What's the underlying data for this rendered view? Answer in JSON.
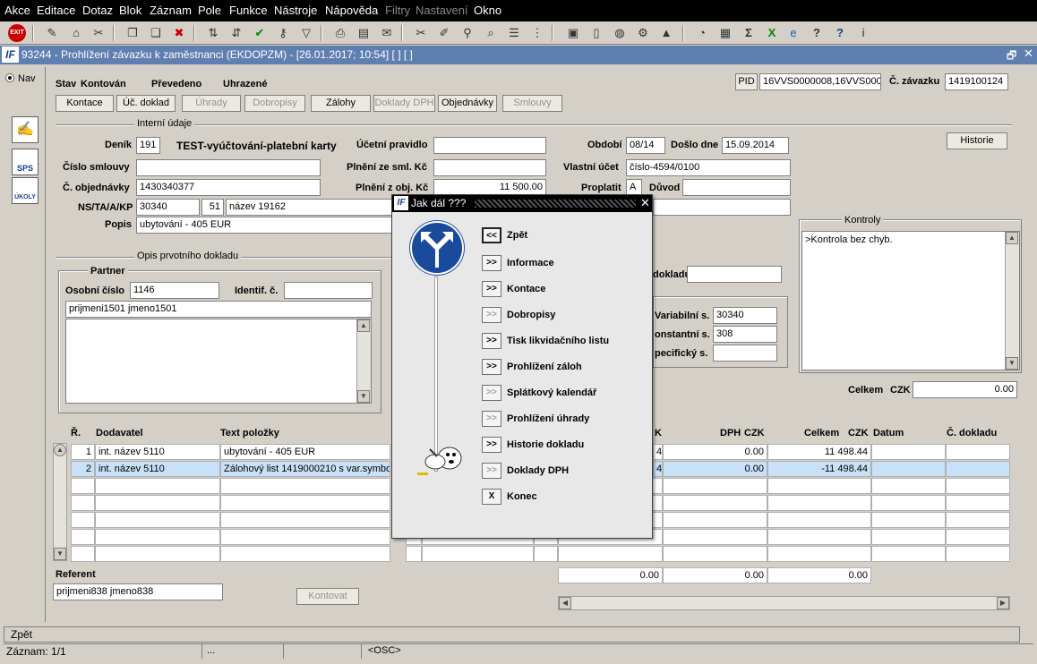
{
  "menu": [
    "Akce",
    "Editace",
    "Dotaz",
    "Blok",
    "Záznam",
    "Pole",
    "Funkce",
    "Nástroje",
    "Nápověda",
    "Filtry",
    "Nastavení",
    "Okno"
  ],
  "menu_disabled": [
    "Filtry",
    "Nastavení"
  ],
  "window": {
    "title": "93244 - Prohlížení závazku k zaměstnanci (EKDOPZM) - [26.01.2017; 10:54]  [ ]  [ ]"
  },
  "nav": {
    "label": "Nav"
  },
  "side_icons": [
    "SPS",
    "ÚKOLY"
  ],
  "status": {
    "stav_label": "Stav",
    "kontovan": "Kontován",
    "prevedeno": "Převedeno",
    "uhrazene": "Uhrazené"
  },
  "pid": {
    "label": "PID",
    "value": "16VVS0000008,16VVS000",
    "cislo_zavazku_label": "Č. závazku",
    "cislo_zavazku": "1419100124"
  },
  "tabs": [
    "Kontace",
    "Úč. doklad",
    "Úhrady",
    "Dobropisy",
    "Zálohy",
    "Doklady DPH",
    "Objednávky",
    "Smlouvy"
  ],
  "tabs_disabled": [
    "Úhrady",
    "Dobropisy",
    "Doklady DPH",
    "Smlouvy"
  ],
  "sections": {
    "interni": "Interní údaje",
    "opis": "Opis prvotního dokladu",
    "partner": "Partner",
    "kontroly": "Kontroly"
  },
  "form": {
    "denik_label": "Deník",
    "denik": "191",
    "denik_nazev": "TEST-vyúčtování-platební karty",
    "ucetni_pravidlo_label": "Účetní pravidlo",
    "ucetni_pravidlo": "",
    "obdobi_label": "Období",
    "obdobi": "08/14",
    "doslo_label": "Došlo dne",
    "doslo": "15.09.2014",
    "historie": "Historie",
    "cislo_smlouvy_label": "Číslo smlouvy",
    "cislo_smlouvy": "",
    "plneni_sml_label": "Plnění ze sml. Kč",
    "plneni_sml": "",
    "vlastni_ucet_label": "Vlastní účet",
    "vlastni_ucet": "číslo-4594/0100",
    "cislo_obj_label": "Č. objednávky",
    "cislo_obj": "1430340377",
    "plneni_obj_label": "Plnění z obj. Kč",
    "plneni_obj": "11 500.00",
    "proplatit_label": "Proplatit",
    "proplatit": "A",
    "duvod_label": "Důvod",
    "duvod": "",
    "ns_label": "NS/TA/A/KP",
    "ns": "30340",
    "ns2": "51",
    "ns_nazev": "název 19162",
    "popis_label": "Popis",
    "popis": "ubytování - 405 EUR",
    "kontroly_text": ">Kontrola bez chyb.",
    "osobni_label": "Osobní číslo",
    "osobni": "1146",
    "identif_label": "Identif. č.",
    "identif": "",
    "partner_name": "prijmeni1501 jmeno1501",
    "dokladu_label": "dokladu",
    "dokladu": "",
    "variabilni_label": "Variabilní s.",
    "variabilni": "30340",
    "konstantni_label": "onstantní s.",
    "konstantni": "308",
    "specificky_label": "pecifický s.",
    "specificky": "",
    "celkem_label": "Celkem",
    "celkem_cur": "CZK",
    "celkem": "0.00"
  },
  "table": {
    "headers": {
      "r": "Ř.",
      "dodavatel": "Dodavatel",
      "text": "Text položky",
      "k": "K",
      "dph": "DPH",
      "dph_cur": "CZK",
      "celkem": "Celkem",
      "celkem_cur": "CZK",
      "datum": "Datum",
      "doklad": "Č. dokladu"
    },
    "rows": [
      {
        "r": "1",
        "dodavatel": "int. název 5110",
        "text": "ubytování - 405 EUR",
        "k": "4",
        "dph": "0.00",
        "celkem": "11 498.44",
        "datum": "",
        "doklad": ""
      },
      {
        "r": "2",
        "dodavatel": "int. název 5110",
        "text": "Zálohový list 1419000210 s var.symbo",
        "k": "4",
        "dph": "0.00",
        "celkem": "-11 498.44",
        "datum": "",
        "doklad": ""
      }
    ],
    "totals": [
      "0.00",
      "0.00",
      "0.00"
    ]
  },
  "referent": {
    "label": "Referent",
    "value": "prijmeni838 jmeno838"
  },
  "kontovat": "Kontovat",
  "statusbar": {
    "message": "Zpět",
    "zaznam": "Záznam: 1/1",
    "dots": "...",
    "osc": "<OSC>"
  },
  "dialog": {
    "title": "Jak dál ???",
    "items": [
      {
        "btn": "<<",
        "label": "Zpět",
        "enabled": true
      },
      {
        "btn": ">>",
        "label": "Informace",
        "enabled": true
      },
      {
        "btn": ">>",
        "label": "Kontace",
        "enabled": true
      },
      {
        "btn": ">>",
        "label": "Dobropisy",
        "enabled": false
      },
      {
        "btn": ">>",
        "label": "Tisk likvidačního listu",
        "enabled": true
      },
      {
        "btn": ">>",
        "label": "Prohlížení záloh",
        "enabled": true
      },
      {
        "btn": ">>",
        "label": "Splátkový kalendář",
        "enabled": false
      },
      {
        "btn": ">>",
        "label": "Prohlížení úhrady",
        "enabled": false
      },
      {
        "btn": ">>",
        "label": "Historie dokladu",
        "enabled": true
      },
      {
        "btn": ">>",
        "label": "Doklady DPH",
        "enabled": false
      },
      {
        "btn": "X",
        "label": "Konec",
        "enabled": true
      }
    ]
  }
}
